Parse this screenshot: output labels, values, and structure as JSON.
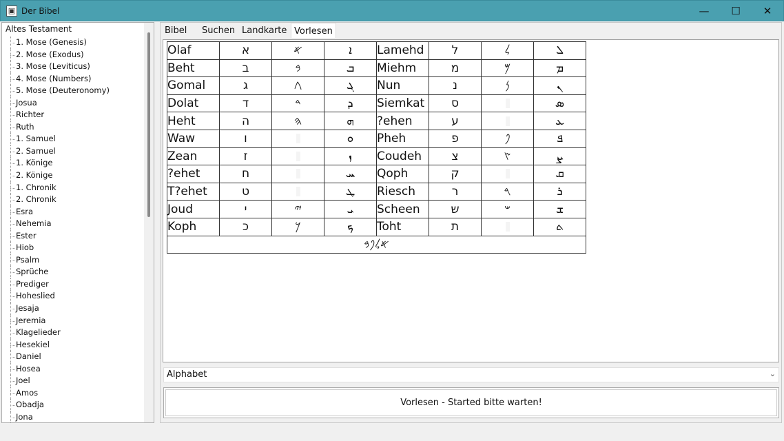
{
  "window": {
    "title": "Der Bibel",
    "minimize": "—",
    "maximize": "☐",
    "close": "✕"
  },
  "tree": {
    "root": "Altes Testament",
    "items": [
      "1. Mose (Genesis)",
      "2. Mose (Exodus)",
      "3. Mose (Leviticus)",
      "4. Mose (Numbers)",
      "5. Mose (Deuteronomy)",
      "Josua",
      "Richter",
      "Ruth",
      "1. Samuel",
      "2. Samuel",
      "1. Könige",
      "2. Könige",
      "1. Chronik",
      "2. Chronik",
      "Esra",
      "Nehemia",
      "Ester",
      "Hiob",
      "Psalm",
      "Sprüche",
      "Prediger",
      "Hoheslied",
      "Jesaja",
      "Jeremia",
      "Klagelieder",
      "Hesekiel",
      "Daniel",
      "Hosea",
      "Joel",
      "Amos",
      "Obadja",
      "Jona"
    ]
  },
  "tabs": [
    "Bibel",
    "Suchen",
    "Landkarte",
    "Vorlesen"
  ],
  "active_tab": "Vorlesen",
  "alphabet": [
    {
      "name": "Olaf",
      "heb": "א",
      "pal": "𐤀",
      "syr": "ܐ",
      "name2": "Lamehd",
      "heb2": "ל",
      "pal2": "𐤋",
      "syr2": "ܠ"
    },
    {
      "name": "Beht",
      "heb": "ב",
      "pal": "𐤁",
      "syr": "ܒ",
      "name2": "Miehm",
      "heb2": "מ",
      "pal2": "𐤌",
      "syr2": "ܡ"
    },
    {
      "name": "Gomal",
      "heb": "ג",
      "pal": "𐤂",
      "syr": "ܓ",
      "name2": "Nun",
      "heb2": "נ",
      "pal2": "𐤍",
      "syr2": "ܢ"
    },
    {
      "name": "Dolat",
      "heb": "ד",
      "pal": "𐤃",
      "syr": "ܕ",
      "name2": "Siemkat",
      "heb2": "ס",
      "pal2": "",
      "syr2": "ܣ"
    },
    {
      "name": "Heht",
      "heb": "ה",
      "pal": "𐤄",
      "syr": "ܗ",
      "name2": "?ehen",
      "heb2": "ע",
      "pal2": "",
      "syr2": "ܥ"
    },
    {
      "name": "Waw",
      "heb": "ו",
      "pal": "",
      "syr": "ܘ",
      "name2": "Pheh",
      "heb2": "פ",
      "pal2": "𐤐",
      "syr2": "ܦ"
    },
    {
      "name": "Zean",
      "heb": "ז",
      "pal": "",
      "syr": "ܙ",
      "name2": "Coudeh",
      "heb2": "צ",
      "pal2": "𐤑",
      "syr2": "ܨ"
    },
    {
      "name": "?ehet",
      "heb": "ח",
      "pal": "",
      "syr": "ܚ",
      "name2": "Qoph",
      "heb2": "ק",
      "pal2": "",
      "syr2": "ܩ"
    },
    {
      "name": "T?ehet",
      "heb": "ט",
      "pal": "",
      "syr": "ܛ",
      "name2": "Riesch",
      "heb2": "ר",
      "pal2": "𐤓",
      "syr2": "ܪ"
    },
    {
      "name": "Joud",
      "heb": "י",
      "pal": "𐤉",
      "syr": "ܝ",
      "name2": "Scheen",
      "heb2": "ש",
      "pal2": "𐤔",
      "syr2": "ܫ"
    },
    {
      "name": "Koph",
      "heb": "כ",
      "pal": "𐤊",
      "syr": "ܟ",
      "name2": "Toht",
      "heb2": "ת",
      "pal2": "",
      "syr2": "ܬ"
    }
  ],
  "footer_script": "𐤀𐤋𐤐𐤁",
  "combo": {
    "value": "Alphabet",
    "arrow": "⌄"
  },
  "status": "Vorlesen - Started bitte warten!"
}
